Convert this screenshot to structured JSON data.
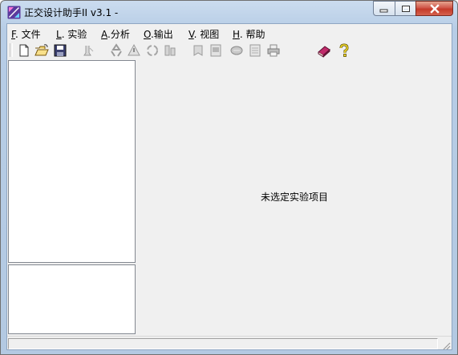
{
  "window": {
    "title": "正交设计助手II v3.1 -",
    "minimize_symbol": "—",
    "maximize_symbol": "☐",
    "close_symbol": "✕"
  },
  "menu": [
    {
      "key": "F",
      "label": ". 文件"
    },
    {
      "key": "L",
      "label": ". 实验"
    },
    {
      "key": "A",
      "label": ".分析"
    },
    {
      "key": "O",
      "label": ".输出"
    },
    {
      "key": "V",
      "label": ". 视图"
    },
    {
      "key": "H",
      "label": ". 帮助"
    }
  ],
  "toolbar": {
    "icons": [
      "new-document-icon",
      "open-folder-icon",
      "save-disk-icon",
      "experiment-icon",
      "recycle-icon",
      "analysis-triangle-icon",
      "recycle-alt-icon",
      "settings-icon",
      "bookmark-icon",
      "report-icon",
      "chart-icon",
      "calendar-icon",
      "print-icon",
      "help-book-icon",
      "help-question-icon"
    ]
  },
  "main": {
    "placeholder": "未选定实验项目"
  },
  "colors": {
    "titlebar": "#b9cde5",
    "client": "#f0f0f0",
    "close_button": "#c94a3a"
  }
}
